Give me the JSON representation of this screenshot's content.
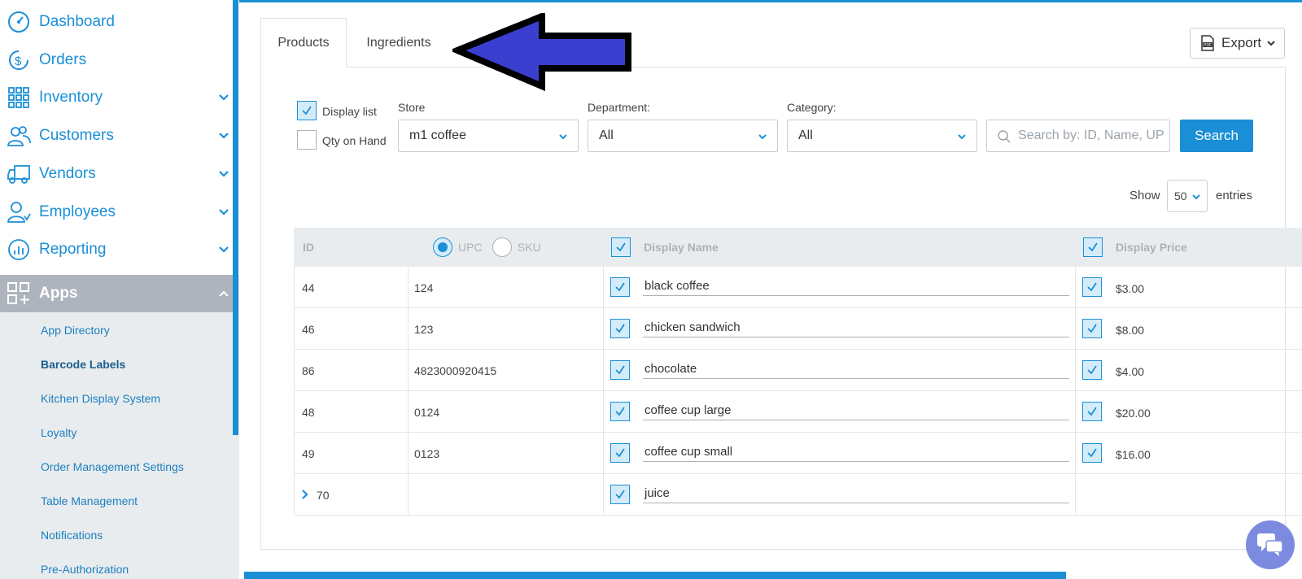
{
  "sidebar": {
    "items": [
      {
        "label": "Dashboard",
        "icon": "dashboard-gauge-icon",
        "has_chevron": false
      },
      {
        "label": "Orders",
        "icon": "orders-dollar-icon",
        "has_chevron": false
      },
      {
        "label": "Inventory",
        "icon": "inventory-grid-icon",
        "has_chevron": true
      },
      {
        "label": "Customers",
        "icon": "customers-people-icon",
        "has_chevron": true
      },
      {
        "label": "Vendors",
        "icon": "vendors-truck-icon",
        "has_chevron": true
      },
      {
        "label": "Employees",
        "icon": "employees-person-icon",
        "has_chevron": true
      },
      {
        "label": "Reporting",
        "icon": "reporting-chart-icon",
        "has_chevron": true
      },
      {
        "label": "Apps",
        "icon": "apps-grid-icon",
        "has_chevron": true,
        "expanded": true
      }
    ],
    "apps_sub": [
      {
        "label": "App Directory",
        "active": false
      },
      {
        "label": "Barcode Labels",
        "active": true
      },
      {
        "label": "Kitchen Display System",
        "active": false
      },
      {
        "label": "Loyalty",
        "active": false
      },
      {
        "label": "Order Management Settings",
        "active": false
      },
      {
        "label": "Table Management",
        "active": false
      },
      {
        "label": "Notifications",
        "active": false
      },
      {
        "label": "Pre-Authorization",
        "active": false
      }
    ]
  },
  "tabs": [
    {
      "label": "Products",
      "active": true
    },
    {
      "label": "Ingredients",
      "active": false
    }
  ],
  "toolbar": {
    "export_label": "Export",
    "export_icon": "pdf-file-icon"
  },
  "filters": {
    "display_list_label": "Display list",
    "display_list_checked": true,
    "qty_on_hand_label": "Qty on Hand",
    "qty_on_hand_checked": false,
    "store_label": "Store",
    "store_value": "m1 coffee",
    "department_label": "Department:",
    "department_value": "All",
    "category_label": "Category:",
    "category_value": "All",
    "search_placeholder": "Search by: ID, Name, UPC",
    "search_button": "Search"
  },
  "entries": {
    "show_label": "Show",
    "value": "50",
    "entries_label": "entries"
  },
  "table": {
    "headers": {
      "id": "ID",
      "upc": "UPC",
      "sku": "SKU",
      "display_name": "Display Name",
      "display_price": "Display Price"
    },
    "code_mode": "UPC",
    "rows": [
      {
        "id": "44",
        "code": "124",
        "name": "black coffee",
        "price": "$3.00",
        "expandable": false
      },
      {
        "id": "46",
        "code": "123",
        "name": "chicken sandwich",
        "price": "$8.00",
        "expandable": false
      },
      {
        "id": "86",
        "code": "4823000920415",
        "name": "chocolate",
        "price": "$4.00",
        "expandable": false
      },
      {
        "id": "48",
        "code": "0124",
        "name": "coffee cup large",
        "price": "$20.00",
        "expandable": false
      },
      {
        "id": "49",
        "code": "0123",
        "name": "coffee cup small",
        "price": "$16.00",
        "expandable": false
      },
      {
        "id": "70",
        "code": "",
        "name": "juice",
        "price": "",
        "expandable": true
      }
    ]
  },
  "colors": {
    "accent": "#1a8fd6",
    "annotation_arrow": "#3a3fd0",
    "chat_button": "#7c8be0"
  }
}
